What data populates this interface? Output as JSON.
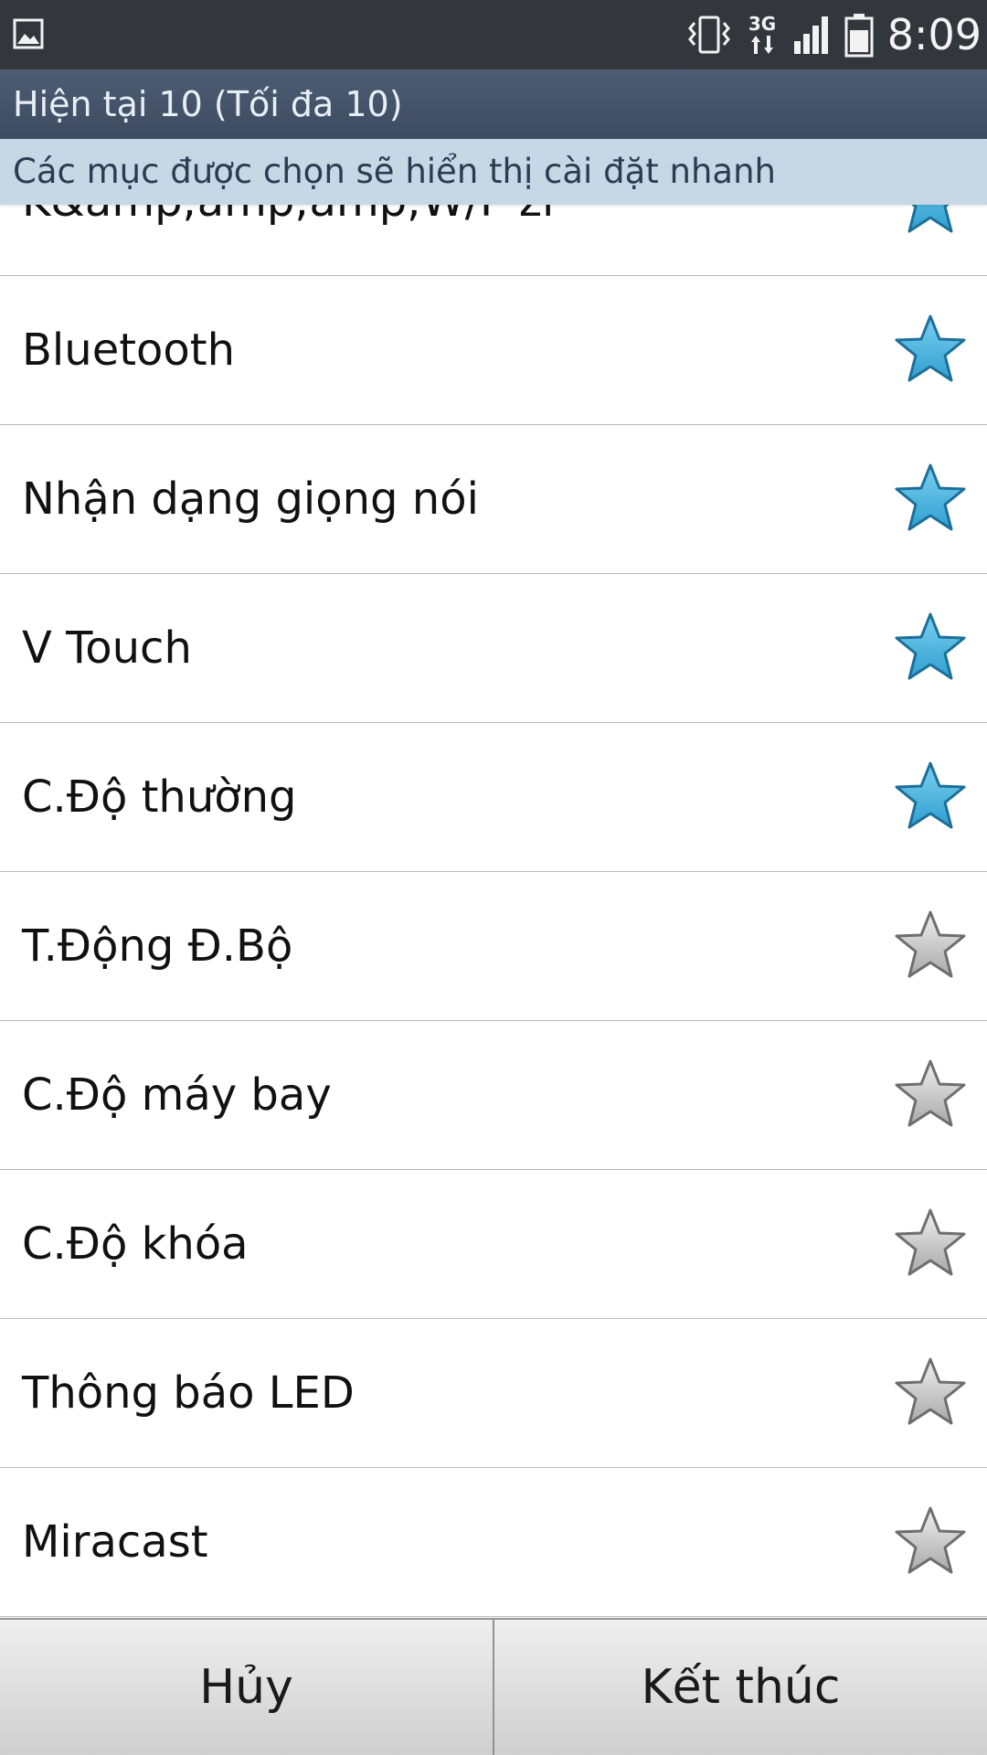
{
  "status_bar": {
    "time": "8:09",
    "network": "3G",
    "icons": [
      "gallery-notification-icon",
      "vibrate-icon",
      "3g-data-icon",
      "signal-icon",
      "battery-icon"
    ]
  },
  "header": {
    "count_text": "Hiện tại 10 (Tối đa 10)",
    "hint_text": "Các mục được chọn sẽ hiển thị cài đặt nhanh"
  },
  "list": {
    "items": [
      {
        "label": "K&amp;amp;amp;W/F zi",
        "selected": true
      },
      {
        "label": "Bluetooth",
        "selected": true
      },
      {
        "label": "Nhận dạng giọng nói",
        "selected": true
      },
      {
        "label": "V Touch",
        "selected": true
      },
      {
        "label": "C.Độ thường",
        "selected": true
      },
      {
        "label": "T.Động Đ.Bộ",
        "selected": false
      },
      {
        "label": "C.Độ máy bay",
        "selected": false
      },
      {
        "label": "C.Độ khóa",
        "selected": false
      },
      {
        "label": "Thông báo LED",
        "selected": false
      },
      {
        "label": "Miracast",
        "selected": false
      }
    ]
  },
  "buttons": {
    "cancel_label": "Hủy",
    "done_label": "Kết thúc"
  },
  "colors": {
    "status_bar_bg": "#33373d",
    "header_bg": "#45556a",
    "hint_bg": "#c8d7e6",
    "star_selected": "#2f9fd0",
    "star_unselected": "#a8a8a8"
  }
}
